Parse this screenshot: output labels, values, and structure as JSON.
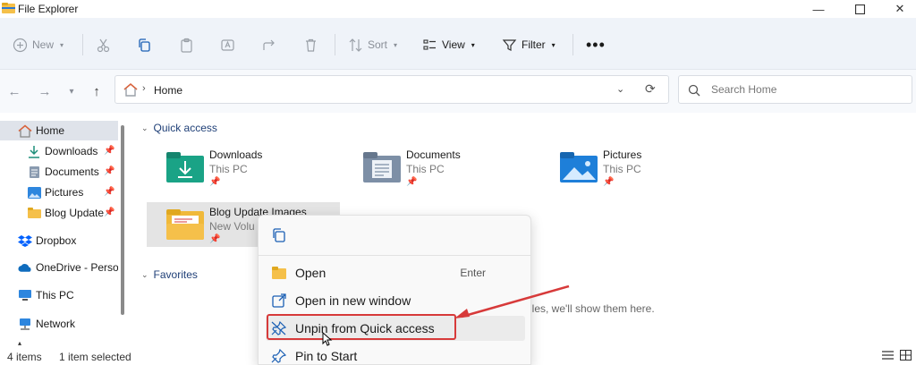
{
  "window": {
    "title": "File Explorer"
  },
  "toolbar": {
    "new_label": "New",
    "sort_label": "Sort",
    "view_label": "View",
    "filter_label": "Filter"
  },
  "address": {
    "path": "Home"
  },
  "search": {
    "placeholder": "Search Home"
  },
  "sidebar": {
    "items": [
      {
        "label": "Home",
        "icon": "home-icon"
      },
      {
        "label": "Downloads",
        "icon": "download-icon"
      },
      {
        "label": "Documents",
        "icon": "documents-icon"
      },
      {
        "label": "Pictures",
        "icon": "pictures-icon"
      },
      {
        "label": "Blog Update",
        "icon": "folder-icon"
      },
      {
        "label": "Dropbox",
        "icon": "dropbox-icon"
      },
      {
        "label": "OneDrive - Person",
        "icon": "onedrive-icon"
      },
      {
        "label": "This PC",
        "icon": "computer-icon"
      },
      {
        "label": "Network",
        "icon": "network-icon"
      }
    ]
  },
  "content": {
    "quick_access_label": "Quick access",
    "favorites_label": "Favorites",
    "empty_hint": "iles, we'll show them here.",
    "tiles": [
      {
        "name": "Downloads",
        "location": "This PC"
      },
      {
        "name": "Documents",
        "location": "This PC"
      },
      {
        "name": "Pictures",
        "location": "This PC"
      },
      {
        "name": "Blog Update Images",
        "location": "New Volu"
      }
    ]
  },
  "context_menu": {
    "items": [
      {
        "label": "Open",
        "shortcut": "Enter"
      },
      {
        "label": "Open in new window"
      },
      {
        "label": "Unpin from Quick access"
      },
      {
        "label": "Pin to Start"
      }
    ]
  },
  "status": {
    "item_count": "4 items",
    "selection": "1 item selected"
  },
  "colors": {
    "accent": "#0f6cbd",
    "highlight_red": "#d73a3a",
    "folder_yellow": "#f5c04a"
  }
}
